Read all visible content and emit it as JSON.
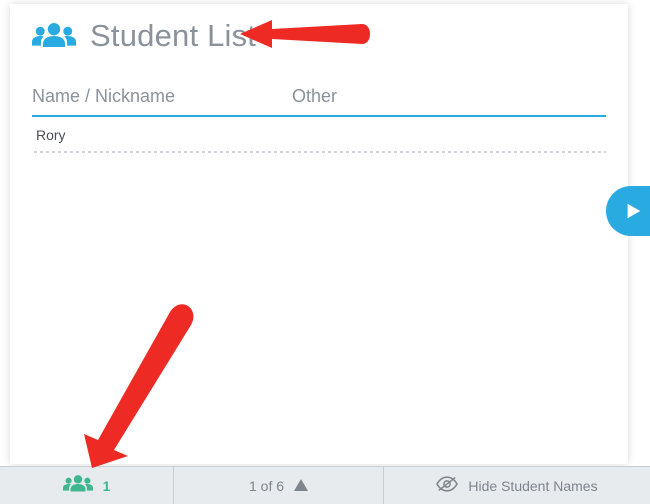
{
  "header": {
    "title": "Student List",
    "icon": "people-icon"
  },
  "columns": {
    "name": "Name / Nickname",
    "other": "Other"
  },
  "rows": [
    {
      "name": "Rory",
      "other": ""
    }
  ],
  "footer": {
    "student_count": "1",
    "pager_text": "1 of 6",
    "hide_label": "Hide Student Names"
  },
  "colors": {
    "accent": "#29abe2",
    "green": "#3eb78f",
    "muted": "#8b929c"
  }
}
